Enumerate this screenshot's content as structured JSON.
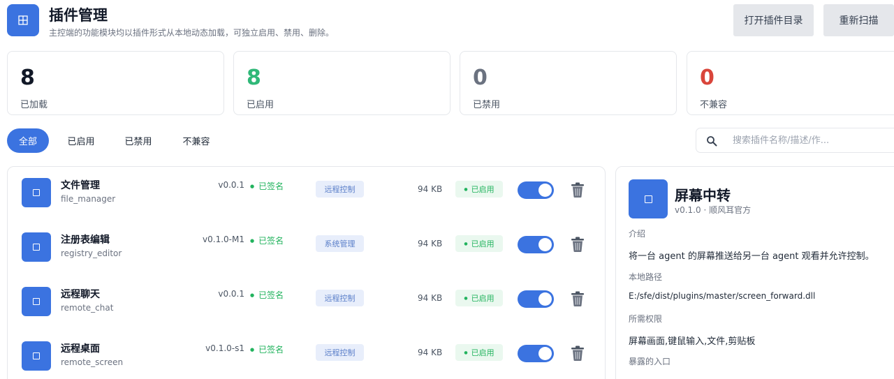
{
  "header": {
    "icon": "grid-icon",
    "title": "插件管理",
    "subtitle": "主控端的功能模块均以插件形式从本地动态加载，可独立启用、禁用、删除。",
    "open_dir_label": "打开插件目录",
    "rescan_label": "重新扫描"
  },
  "stats": [
    {
      "value": "8",
      "label": "已加载",
      "color": "#111827"
    },
    {
      "value": "8",
      "label": "已启用",
      "color": "#2fb878"
    },
    {
      "value": "0",
      "label": "已禁用",
      "color": "#6b7280"
    },
    {
      "value": "0",
      "label": "不兼容",
      "color": "#d9453b"
    }
  ],
  "tabs": [
    {
      "label": "全部",
      "active": true
    },
    {
      "label": "已启用",
      "active": false
    },
    {
      "label": "已禁用",
      "active": false
    },
    {
      "label": "不兼容",
      "active": false
    }
  ],
  "search": {
    "placeholder": "搜索插件名称/描述/作...",
    "icon": "search-icon"
  },
  "plugins": [
    {
      "name": "文件管理",
      "id": "file_manager",
      "version": "v0.0.1",
      "signed": "已签名",
      "category": "远程控制",
      "size": "94 KB",
      "status": "已启用",
      "enabled": true
    },
    {
      "name": "注册表编辑",
      "id": "registry_editor",
      "version": "v0.1.0-M1",
      "signed": "已签名",
      "category": "系统管理",
      "size": "94 KB",
      "status": "已启用",
      "enabled": true
    },
    {
      "name": "远程聊天",
      "id": "remote_chat",
      "version": "v0.0.1",
      "signed": "已签名",
      "category": "远程控制",
      "size": "94 KB",
      "status": "已启用",
      "enabled": true
    },
    {
      "name": "远程桌面",
      "id": "remote_screen",
      "version": "v0.1.0-s1",
      "signed": "已签名",
      "category": "远程控制",
      "size": "94 KB",
      "status": "已启用",
      "enabled": true
    }
  ],
  "detail": {
    "name": "屏幕中转",
    "meta": "v0.1.0 · 顺风耳官方",
    "intro_label": "介绍",
    "intro": "将一台 agent 的屏幕推送给另一台 agent 观看并允许控制。",
    "path_label": "本地路径",
    "path": "E:/sfe/dist/plugins/master/screen_forward.dll",
    "perm_label": "所需权限",
    "perm": "屏幕画面,键鼠输入,文件,剪贴板",
    "entry_label": "暴露的入口"
  },
  "colors": {
    "accent": "#3b73e0",
    "success": "#22b35e",
    "danger": "#d9453b"
  }
}
